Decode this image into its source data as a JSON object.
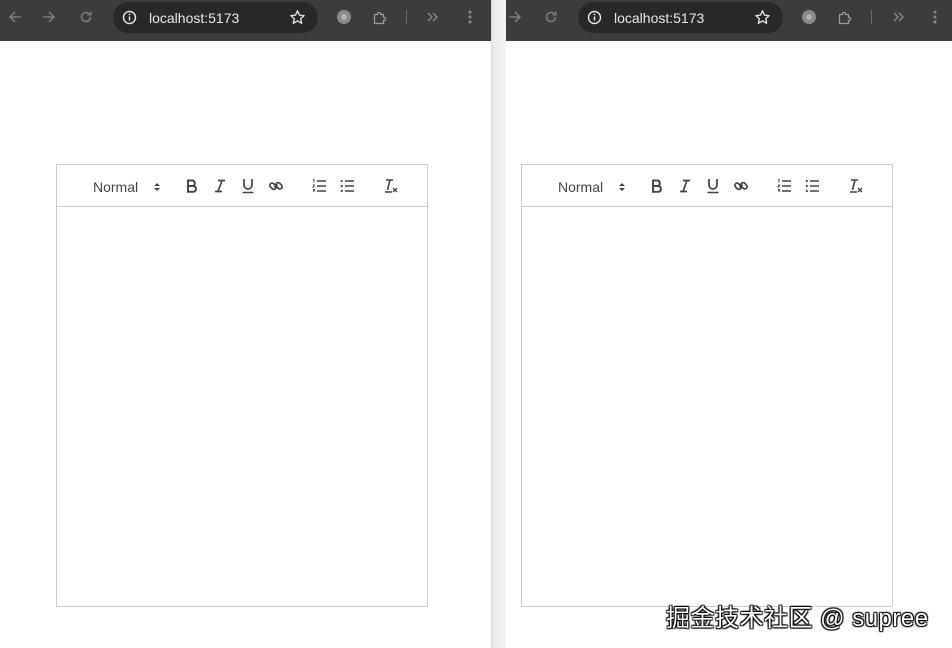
{
  "windows": {
    "left": {
      "url": "localhost:5173",
      "editor": {
        "header_select": "Normal",
        "content": ""
      }
    },
    "right": {
      "url": "localhost:5173",
      "editor": {
        "header_select": "Normal",
        "content": ""
      }
    }
  },
  "toolbar_icons": [
    "bold-icon",
    "italic-icon",
    "underline-icon",
    "link-icon",
    "ordered-list-icon",
    "bullet-list-icon",
    "clear-format-icon"
  ],
  "colors": {
    "chrome_bg": "#3c3c3c",
    "omnibox_bg": "#282828",
    "border": "#cccccc",
    "icon": "#444444"
  },
  "watermark": "掘金技术社区 @ supree"
}
